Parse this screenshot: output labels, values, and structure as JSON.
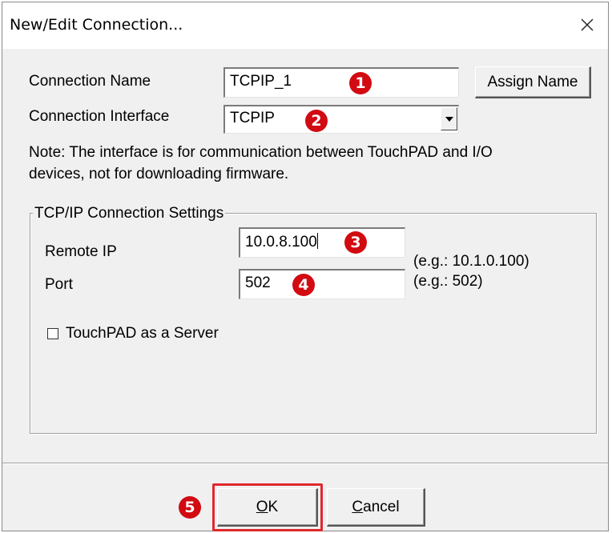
{
  "window": {
    "title": "New/Edit Connection..."
  },
  "connection_name": {
    "label": "Connection Name",
    "value": "TCPIP_1",
    "assign_button": "Assign Name"
  },
  "connection_interface": {
    "label": "Connection Interface",
    "selected": "TCPIP"
  },
  "note": {
    "line1": "Note: The interface is for communication between TouchPAD and I/O",
    "line2": "devices, not for downloading firmware."
  },
  "tcpip": {
    "group_title": "TCP/IP Connection Settings",
    "remote_ip_label": "Remote IP",
    "remote_ip_value": "10.0.8.100",
    "remote_ip_hint": "(e.g.: 10.1.0.100)",
    "port_label": "Port",
    "port_value": "502",
    "port_hint": "(e.g.: 502)",
    "server_checkbox_label": "TouchPAD as a Server",
    "server_checkbox_checked": false
  },
  "buttons": {
    "ok_mnemonic": "O",
    "ok_rest": "K",
    "cancel_mnemonic": "C",
    "cancel_rest": "ancel"
  },
  "annotations": {
    "b1": "1",
    "b2": "2",
    "b3": "3",
    "b4": "4",
    "b5": "5"
  },
  "colors": {
    "annotation": "#d20a11",
    "highlight": "#e0282d",
    "dialog_bg": "#f0f0f0"
  },
  "icons": {
    "close": "close-icon",
    "dropdown": "chevron-down-icon"
  }
}
